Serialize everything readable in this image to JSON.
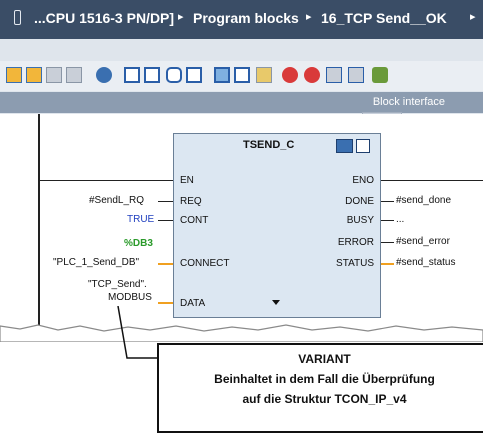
{
  "breadcrumb": {
    "items": [
      "...CPU 1516-3 PN/DP]",
      "Program blocks",
      "16_TCP Send__OK"
    ],
    "separator": "▸",
    "overflow": "▸"
  },
  "toolbar": {
    "block_interface_label": "Block interface"
  },
  "block": {
    "name": "TSEND_C",
    "inputs": [
      "EN",
      "REQ",
      "CONT",
      "CONNECT",
      "DATA"
    ],
    "outputs": [
      "ENO",
      "DONE",
      "BUSY",
      "ERROR",
      "STATUS"
    ]
  },
  "parameters": {
    "req": "#SendL_RQ",
    "cont": "TRUE",
    "connect_db": "%DB3",
    "connect": "\"PLC_1_Send_DB\"",
    "data_line1": "\"TCP_Send\".",
    "data_line2": "MODBUS",
    "done": "#send_done",
    "busy": "...",
    "error": "#send_error",
    "status": "#send_status"
  },
  "callout": {
    "title": "VARIANT",
    "line1": "Beinhaltet in dem Fall die Überprüfung",
    "line2": "auf die Struktur TCON_IP_v4"
  },
  "colors": {
    "breadcrumb_bg": "#3a4d66",
    "block_bg": "#dce7f2",
    "bool_true": "#1f3fbf",
    "db_green": "#2a9a2a",
    "wire_orange": "#f0a020"
  }
}
